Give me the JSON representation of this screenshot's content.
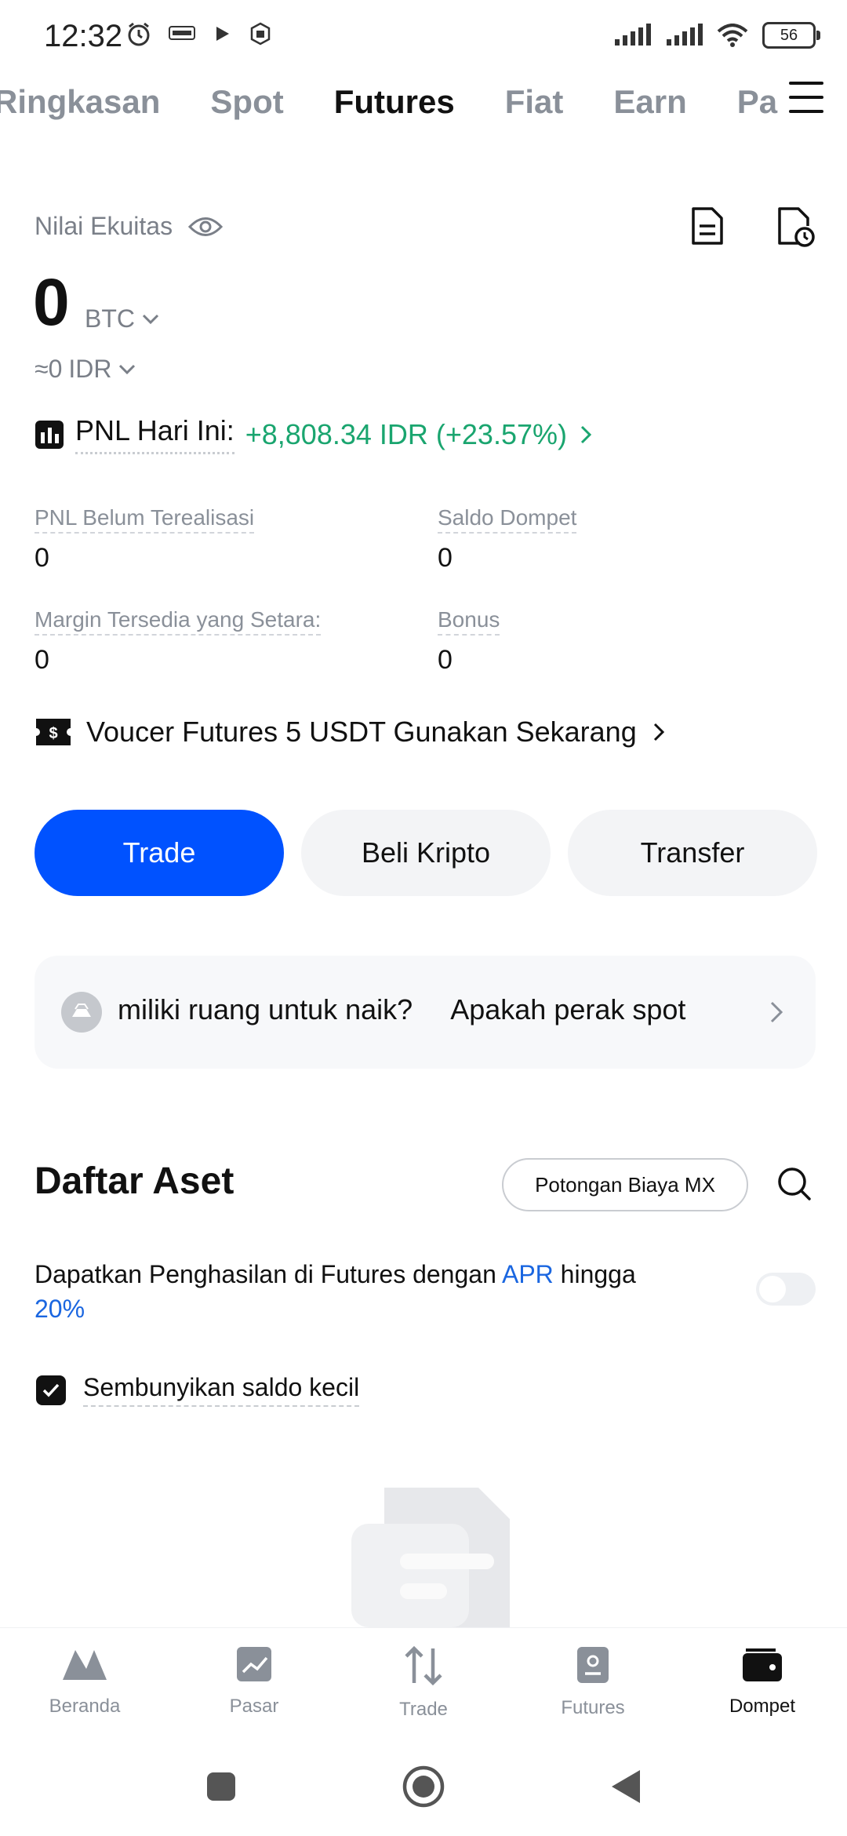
{
  "status_bar": {
    "time": "12:32",
    "battery": "56"
  },
  "tabs": [
    "Ringkasan",
    "Spot",
    "Futures",
    "Fiat",
    "Earn",
    "Pas"
  ],
  "equity": {
    "label": "Nilai Ekuitas",
    "value": "0",
    "currency": "BTC",
    "approx": "≈0",
    "fiat": "IDR"
  },
  "pnl": {
    "label": "PNL Hari Ini:",
    "value": "+8,808.34 IDR (+23.57%)"
  },
  "stats": {
    "unrealized_label": "PNL Belum Terealisasi",
    "unrealized_value": "0",
    "wallet_label": "Saldo Dompet",
    "wallet_value": "0",
    "margin_label": "Margin Tersedia yang Setara:",
    "margin_value": "0",
    "bonus_label": "Bonus",
    "bonus_value": "0"
  },
  "voucher": {
    "text": "Voucer Futures 5 USDT Gunakan Sekarang"
  },
  "actions": {
    "trade": "Trade",
    "buy": "Beli Kripto",
    "transfer": "Transfer"
  },
  "banner": {
    "text": "miliki ruang untuk naik?     Apakah perak spot"
  },
  "assets": {
    "title": "Daftar Aset",
    "fee_chip": "Potongan Biaya MX",
    "earn_prefix": "Dapatkan Penghasilan di Futures dengan ",
    "earn_link": "APR",
    "earn_mid": " hingga ",
    "earn_rate": "20%",
    "hide_small": "Sembunyikan saldo kecil"
  },
  "bottom_nav": {
    "home": "Beranda",
    "market": "Pasar",
    "trade": "Trade",
    "futures": "Futures",
    "wallet": "Dompet"
  },
  "colors": {
    "primary": "#0052ff",
    "positive": "#1aa56f",
    "link": "#1a66e0"
  }
}
